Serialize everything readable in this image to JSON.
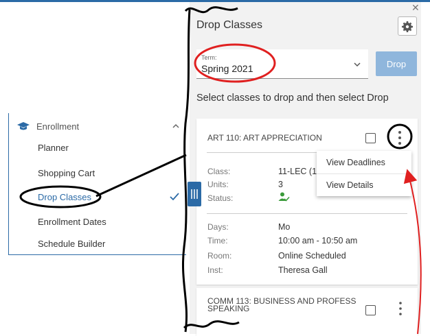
{
  "sidebar": {
    "section_label": "Enrollment",
    "items": [
      {
        "label": "Planner"
      },
      {
        "label": "Shopping Cart"
      },
      {
        "label": "Drop Classes",
        "active": true
      },
      {
        "label": "Enrollment Dates"
      },
      {
        "label": "Schedule Builder"
      }
    ]
  },
  "panel": {
    "title": "Drop Classes",
    "term_label": "Term:",
    "term_value": "Spring 2021",
    "drop_button": "Drop",
    "instruction": "Select classes to drop and then select Drop"
  },
  "class_card": {
    "title": "ART 110: ART APPRECIATION",
    "fields": [
      {
        "label": "Class:",
        "value": "11-LEC (1"
      },
      {
        "label": "Units:",
        "value": "3"
      },
      {
        "label": "Status:",
        "value": ""
      }
    ],
    "schedule": [
      {
        "label": "Days:",
        "value": "Mo"
      },
      {
        "label": "Time:",
        "value": "10:00 am - 10:50 am"
      },
      {
        "label": "Room:",
        "value": "Online Scheduled"
      },
      {
        "label": "Inst:",
        "value": "Theresa Gall"
      }
    ]
  },
  "context_menu": {
    "items": [
      {
        "label": "View Deadlines"
      },
      {
        "label": "View Details"
      }
    ]
  },
  "class_card_2": {
    "title": "COMM 113: BUSINESS AND PROFESS SPEAKING"
  },
  "colors": {
    "accent": "#2b6aa6",
    "drop_button": "#8fb6dc",
    "status_enrolled": "#3a9a3a",
    "annotation_red": "#e02020",
    "annotation_black": "#000000"
  }
}
